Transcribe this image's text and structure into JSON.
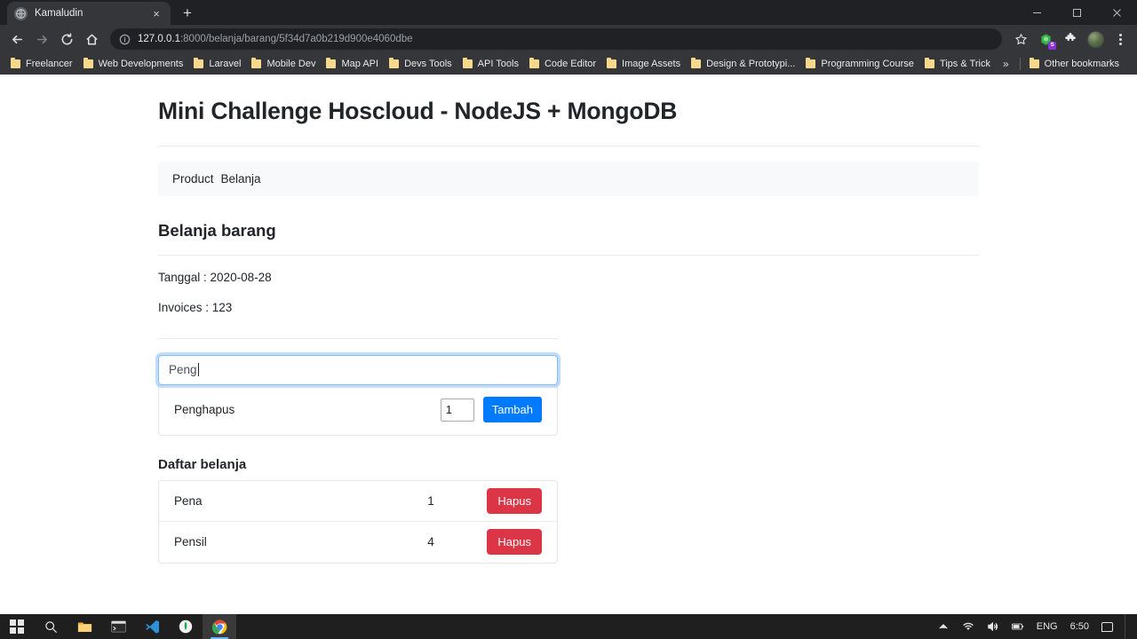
{
  "browser": {
    "tab": {
      "title": "Kamaludin",
      "favicon": "globe-icon",
      "close": "×"
    },
    "new_tab_label": "+",
    "window_controls": {
      "minimize": "—",
      "maximize": "❐",
      "close": "✕"
    },
    "nav": {
      "back": "←",
      "forward": "→",
      "reload": "↻",
      "home": "⌂"
    },
    "omnibox": {
      "host": "127.0.0.1",
      "path": ":8000/belanja/barang/5f34d7a0b219d900e4060dbe",
      "full_url": "127.0.0.1:8000/belanja/barang/5f34d7a0b219d900e4060dbe",
      "security_icon": "info-circle-icon"
    },
    "toolbar_icons": {
      "bookmark_star": "star-icon",
      "extension_s": "extension-icon",
      "extension_badge": "S",
      "puzzle": "puzzle-icon",
      "profile": "avatar-icon",
      "menu": "three-dot-menu-icon"
    },
    "bookmarks": [
      {
        "label": "Freelancer"
      },
      {
        "label": "Web Developments"
      },
      {
        "label": "Laravel"
      },
      {
        "label": "Mobile Dev"
      },
      {
        "label": "Map API"
      },
      {
        "label": "Devs Tools"
      },
      {
        "label": "API Tools"
      },
      {
        "label": "Code Editor"
      },
      {
        "label": "Image Assets"
      },
      {
        "label": "Design & Prototypi..."
      },
      {
        "label": "Programming Course"
      },
      {
        "label": "Tips & Trick"
      }
    ],
    "bookmarks_overflow": "»",
    "other_bookmarks": "Other bookmarks"
  },
  "page": {
    "title": "Mini Challenge Hoscloud - NodeJS + MongoDB",
    "breadcrumb": [
      {
        "label": "Product"
      },
      {
        "label": "Belanja"
      }
    ],
    "section_title": "Belanja barang",
    "meta": {
      "tanggal": "Tanggal : 2020-08-28",
      "invoices": "Invoices : 123"
    },
    "search": {
      "value": "Peng",
      "placeholder": ""
    },
    "suggestion": {
      "name": "Penghapus",
      "qty_value": "1",
      "add_button": "Tambah"
    },
    "list": {
      "title": "Daftar belanja",
      "delete_button": "Hapus",
      "items": [
        {
          "name": "Pena",
          "qty": "1"
        },
        {
          "name": "Pensil",
          "qty": "4"
        }
      ]
    },
    "colors": {
      "primary": "#007bff",
      "danger": "#dc3545",
      "focus_border": "#80bdff",
      "breadcrumb_bg": "#f8f9fa"
    }
  },
  "taskbar": {
    "items": [
      {
        "name": "start-button",
        "label": "Start"
      },
      {
        "name": "search-button",
        "label": "Search"
      },
      {
        "name": "file-explorer-button",
        "label": "File Explorer"
      },
      {
        "name": "terminal-button",
        "label": "Terminal"
      },
      {
        "name": "vscode-button",
        "label": "Visual Studio Code"
      },
      {
        "name": "mongodb-compass-button",
        "label": "MongoDB Compass"
      },
      {
        "name": "chrome-button",
        "label": "Google Chrome"
      }
    ],
    "tray": {
      "chevron": "∧",
      "language": "ENG",
      "clock": "6:50"
    }
  }
}
